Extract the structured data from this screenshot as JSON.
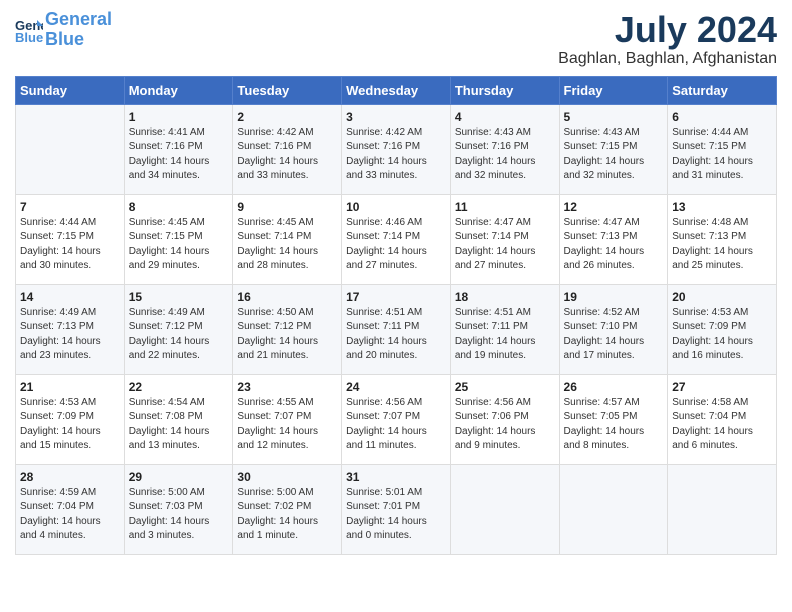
{
  "header": {
    "logo_line1": "General",
    "logo_line2": "Blue",
    "month": "July 2024",
    "location": "Baghlan, Baghlan, Afghanistan"
  },
  "weekdays": [
    "Sunday",
    "Monday",
    "Tuesday",
    "Wednesday",
    "Thursday",
    "Friday",
    "Saturday"
  ],
  "weeks": [
    [
      {
        "day": "",
        "info": ""
      },
      {
        "day": "1",
        "info": "Sunrise: 4:41 AM\nSunset: 7:16 PM\nDaylight: 14 hours\nand 34 minutes."
      },
      {
        "day": "2",
        "info": "Sunrise: 4:42 AM\nSunset: 7:16 PM\nDaylight: 14 hours\nand 33 minutes."
      },
      {
        "day": "3",
        "info": "Sunrise: 4:42 AM\nSunset: 7:16 PM\nDaylight: 14 hours\nand 33 minutes."
      },
      {
        "day": "4",
        "info": "Sunrise: 4:43 AM\nSunset: 7:16 PM\nDaylight: 14 hours\nand 32 minutes."
      },
      {
        "day": "5",
        "info": "Sunrise: 4:43 AM\nSunset: 7:15 PM\nDaylight: 14 hours\nand 32 minutes."
      },
      {
        "day": "6",
        "info": "Sunrise: 4:44 AM\nSunset: 7:15 PM\nDaylight: 14 hours\nand 31 minutes."
      }
    ],
    [
      {
        "day": "7",
        "info": "Sunrise: 4:44 AM\nSunset: 7:15 PM\nDaylight: 14 hours\nand 30 minutes."
      },
      {
        "day": "8",
        "info": "Sunrise: 4:45 AM\nSunset: 7:15 PM\nDaylight: 14 hours\nand 29 minutes."
      },
      {
        "day": "9",
        "info": "Sunrise: 4:45 AM\nSunset: 7:14 PM\nDaylight: 14 hours\nand 28 minutes."
      },
      {
        "day": "10",
        "info": "Sunrise: 4:46 AM\nSunset: 7:14 PM\nDaylight: 14 hours\nand 27 minutes."
      },
      {
        "day": "11",
        "info": "Sunrise: 4:47 AM\nSunset: 7:14 PM\nDaylight: 14 hours\nand 27 minutes."
      },
      {
        "day": "12",
        "info": "Sunrise: 4:47 AM\nSunset: 7:13 PM\nDaylight: 14 hours\nand 26 minutes."
      },
      {
        "day": "13",
        "info": "Sunrise: 4:48 AM\nSunset: 7:13 PM\nDaylight: 14 hours\nand 25 minutes."
      }
    ],
    [
      {
        "day": "14",
        "info": "Sunrise: 4:49 AM\nSunset: 7:13 PM\nDaylight: 14 hours\nand 23 minutes."
      },
      {
        "day": "15",
        "info": "Sunrise: 4:49 AM\nSunset: 7:12 PM\nDaylight: 14 hours\nand 22 minutes."
      },
      {
        "day": "16",
        "info": "Sunrise: 4:50 AM\nSunset: 7:12 PM\nDaylight: 14 hours\nand 21 minutes."
      },
      {
        "day": "17",
        "info": "Sunrise: 4:51 AM\nSunset: 7:11 PM\nDaylight: 14 hours\nand 20 minutes."
      },
      {
        "day": "18",
        "info": "Sunrise: 4:51 AM\nSunset: 7:11 PM\nDaylight: 14 hours\nand 19 minutes."
      },
      {
        "day": "19",
        "info": "Sunrise: 4:52 AM\nSunset: 7:10 PM\nDaylight: 14 hours\nand 17 minutes."
      },
      {
        "day": "20",
        "info": "Sunrise: 4:53 AM\nSunset: 7:09 PM\nDaylight: 14 hours\nand 16 minutes."
      }
    ],
    [
      {
        "day": "21",
        "info": "Sunrise: 4:53 AM\nSunset: 7:09 PM\nDaylight: 14 hours\nand 15 minutes."
      },
      {
        "day": "22",
        "info": "Sunrise: 4:54 AM\nSunset: 7:08 PM\nDaylight: 14 hours\nand 13 minutes."
      },
      {
        "day": "23",
        "info": "Sunrise: 4:55 AM\nSunset: 7:07 PM\nDaylight: 14 hours\nand 12 minutes."
      },
      {
        "day": "24",
        "info": "Sunrise: 4:56 AM\nSunset: 7:07 PM\nDaylight: 14 hours\nand 11 minutes."
      },
      {
        "day": "25",
        "info": "Sunrise: 4:56 AM\nSunset: 7:06 PM\nDaylight: 14 hours\nand 9 minutes."
      },
      {
        "day": "26",
        "info": "Sunrise: 4:57 AM\nSunset: 7:05 PM\nDaylight: 14 hours\nand 8 minutes."
      },
      {
        "day": "27",
        "info": "Sunrise: 4:58 AM\nSunset: 7:04 PM\nDaylight: 14 hours\nand 6 minutes."
      }
    ],
    [
      {
        "day": "28",
        "info": "Sunrise: 4:59 AM\nSunset: 7:04 PM\nDaylight: 14 hours\nand 4 minutes."
      },
      {
        "day": "29",
        "info": "Sunrise: 5:00 AM\nSunset: 7:03 PM\nDaylight: 14 hours\nand 3 minutes."
      },
      {
        "day": "30",
        "info": "Sunrise: 5:00 AM\nSunset: 7:02 PM\nDaylight: 14 hours\nand 1 minute."
      },
      {
        "day": "31",
        "info": "Sunrise: 5:01 AM\nSunset: 7:01 PM\nDaylight: 14 hours\nand 0 minutes."
      },
      {
        "day": "",
        "info": ""
      },
      {
        "day": "",
        "info": ""
      },
      {
        "day": "",
        "info": ""
      }
    ]
  ]
}
